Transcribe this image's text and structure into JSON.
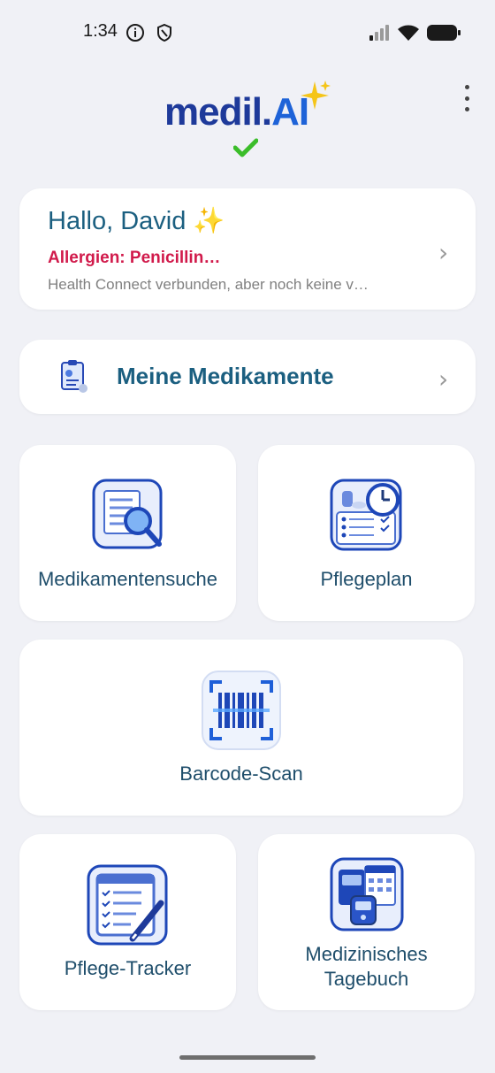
{
  "status_bar": {
    "time": "1:34",
    "icons": [
      "info-icon",
      "shield-icon",
      "signal-icon",
      "wifi-icon",
      "battery-icon"
    ]
  },
  "app": {
    "logo_text_part1": "medil.",
    "logo_text_part2": "AI",
    "menu_icon": "more-vert-icon"
  },
  "greeting": {
    "title": "Hallo, David ✨",
    "allergy": "Allergien: Penicillin…",
    "health_status": "Health Connect verbunden, aber noch keine v…"
  },
  "meds": {
    "label": "Meine Medikamente"
  },
  "tiles": {
    "search": "Medikamentensuche",
    "plan": "Pflegeplan",
    "barcode": "Barcode-Scan",
    "tracker": "Pflege-Tracker",
    "diary_line1": "Medizinisches",
    "diary_line2": "Tagebuch"
  },
  "colors": {
    "background": "#f0f1f6",
    "card": "#ffffff",
    "primary_text": "#1b5f80",
    "allergy": "#d11a4b",
    "icon_blue": "#1e47b8"
  }
}
